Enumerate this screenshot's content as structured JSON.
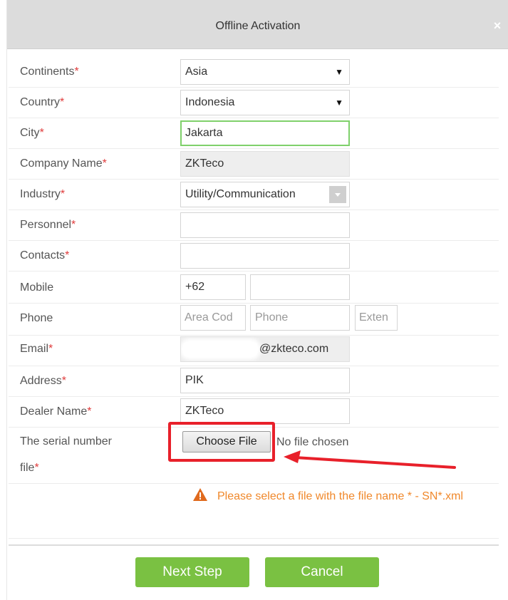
{
  "dialog": {
    "title": "Offline Activation",
    "close_glyph": "×"
  },
  "form": {
    "continents": {
      "label": "Continents",
      "value": "Asia"
    },
    "country": {
      "label": "Country",
      "value": "Indonesia"
    },
    "city": {
      "label": "City",
      "value": "Jakarta"
    },
    "company_name": {
      "label": "Company Name",
      "value": "ZKTeco"
    },
    "industry": {
      "label": "Industry",
      "value": "Utility/Communication"
    },
    "personnel": {
      "label": "Personnel",
      "value": ""
    },
    "contacts": {
      "label": "Contacts",
      "value": ""
    },
    "mobile": {
      "label": "Mobile",
      "code": "+62",
      "number": ""
    },
    "phone": {
      "label": "Phone",
      "area_placeholder": "Area Cod",
      "phone_placeholder": "Phone",
      "ext_placeholder": "Exten"
    },
    "email": {
      "label": "Email",
      "domain": "@zkteco.com"
    },
    "address": {
      "label": "Address",
      "value": "PIK"
    },
    "dealer_name": {
      "label": "Dealer Name",
      "value": "ZKTeco"
    },
    "serial_file": {
      "label_line1": "The serial number",
      "label_line2": "file",
      "button": "Choose File",
      "status": "No file chosen"
    },
    "required_marker": "*",
    "warning": "Please select a file with the file name * - SN*.xml"
  },
  "footer": {
    "next_label": "Next Step",
    "cancel_label": "Cancel"
  },
  "colors": {
    "accent_green": "#7ac142",
    "warning_orange": "#f0882b",
    "required_red": "#e03c3c",
    "annotation_red": "#e8202a"
  }
}
